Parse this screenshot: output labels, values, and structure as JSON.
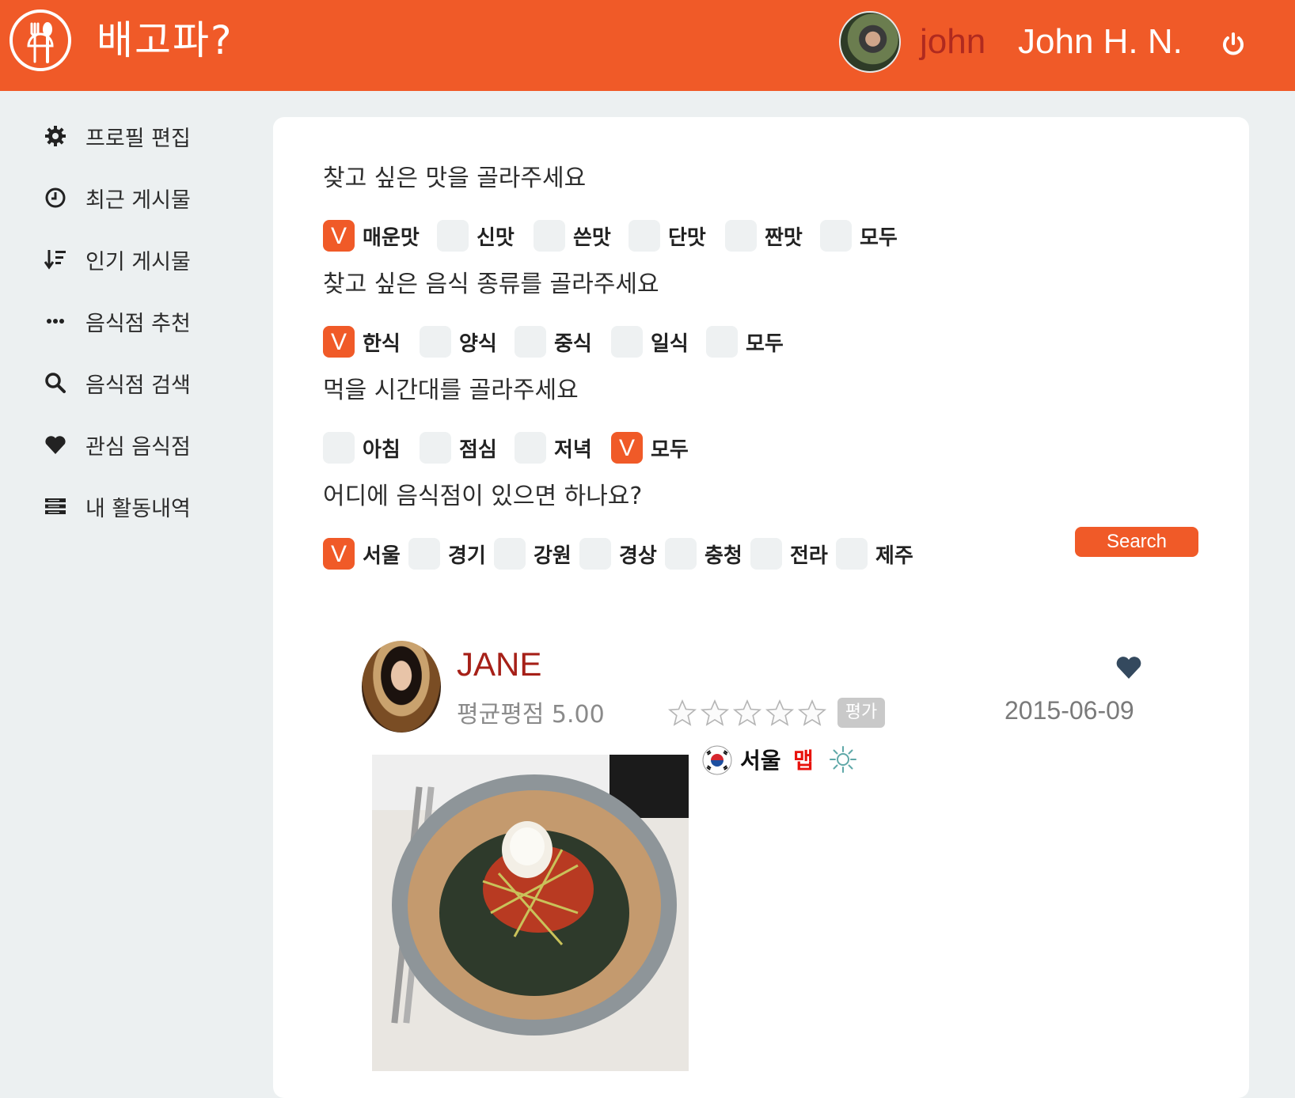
{
  "header": {
    "logo_text": "배고파?",
    "user_id": "john",
    "user_name": "John H. N.",
    "accent": "#f05a28"
  },
  "sidebar": {
    "items": [
      {
        "label": "프로필 편집",
        "icon": "gear-icon"
      },
      {
        "label": "최근 게시물",
        "icon": "clock-icon"
      },
      {
        "label": "인기 게시물",
        "icon": "sort-desc-icon"
      },
      {
        "label": "음식점 추천",
        "icon": "ellipsis-icon"
      },
      {
        "label": "음식점 검색",
        "icon": "search-icon"
      },
      {
        "label": "관심 음식점",
        "icon": "heart-icon"
      },
      {
        "label": "내 활동내역",
        "icon": "list-icon"
      }
    ]
  },
  "filters": {
    "taste": {
      "question": "찾고 싶은 맛을 골라주세요",
      "options": [
        {
          "label": "매운맛",
          "checked": true
        },
        {
          "label": "신맛",
          "checked": false
        },
        {
          "label": "쓴맛",
          "checked": false
        },
        {
          "label": "단맛",
          "checked": false
        },
        {
          "label": "짠맛",
          "checked": false
        },
        {
          "label": "모두",
          "checked": false
        }
      ]
    },
    "cuisine": {
      "question": "찾고 싶은 음식 종류를 골라주세요",
      "options": [
        {
          "label": "한식",
          "checked": true
        },
        {
          "label": "양식",
          "checked": false
        },
        {
          "label": "중식",
          "checked": false
        },
        {
          "label": "일식",
          "checked": false
        },
        {
          "label": "모두",
          "checked": false
        }
      ]
    },
    "time": {
      "question": "먹을 시간대를 골라주세요",
      "options": [
        {
          "label": "아침",
          "checked": false
        },
        {
          "label": "점심",
          "checked": false
        },
        {
          "label": "저녁",
          "checked": false
        },
        {
          "label": "모두",
          "checked": true
        }
      ]
    },
    "region": {
      "question": "어디에 음식점이 있으면 하나요?",
      "options": [
        {
          "label": "서울",
          "checked": true
        },
        {
          "label": "경기",
          "checked": false
        },
        {
          "label": "강원",
          "checked": false
        },
        {
          "label": "경상",
          "checked": false
        },
        {
          "label": "충청",
          "checked": false
        },
        {
          "label": "전라",
          "checked": false
        },
        {
          "label": "제주",
          "checked": false
        }
      ]
    },
    "check_mark": "V",
    "search_label": "Search"
  },
  "post": {
    "user": "JANE",
    "rating_text": "평균평점 5.00",
    "stars_total": 5,
    "stars_filled": 0,
    "eval_label": "평가",
    "date": "2015-06-09",
    "region_tag": "서울",
    "taste_tag": "맵"
  }
}
